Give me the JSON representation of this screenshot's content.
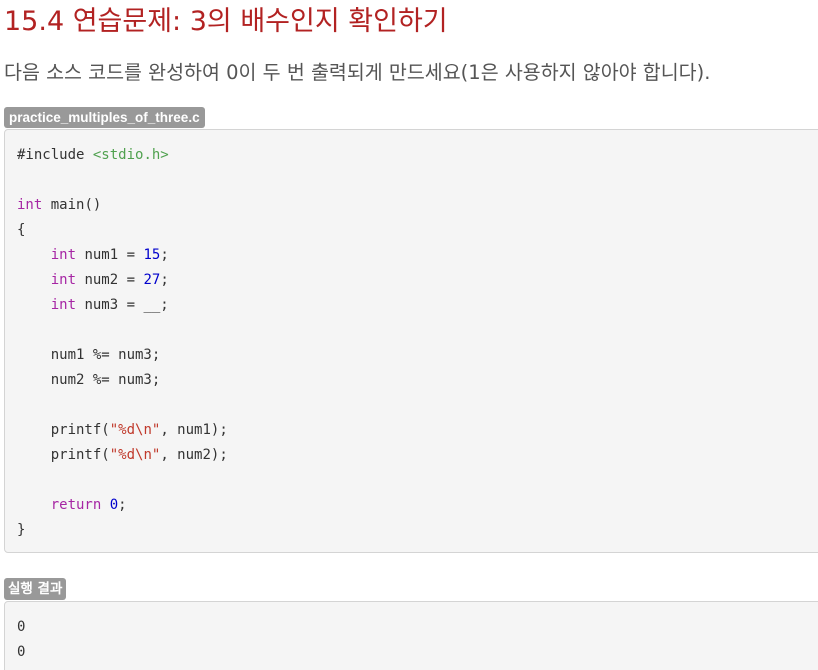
{
  "title": "15.4 연습문제: 3의 배수인지 확인하기",
  "instruction": "다음 소스 코드를 완성하여 0이 두 번 출력되게 만드세요(1은 사용하지 않아야 합니다).",
  "code_file": "practice_multiples_of_three.c",
  "code": {
    "include_directive": "#include",
    "include_header": "<stdio.h>",
    "type_int": "int",
    "main_sig": " main()",
    "open_brace": "{",
    "close_brace": "}",
    "var1": " num1 = ",
    "var1_value": "15",
    "var2": " num2 = ",
    "var2_value": "27",
    "var3": " num3 = __;",
    "mod1": "num1 %= num3;",
    "mod2": "num2 %= num3;",
    "printf": "printf(",
    "format": "\"%d\\n\"",
    "arg1": ", num1);",
    "arg2": ", num2);",
    "return_kw": "return",
    "return_value": "0",
    "semicolon": ";"
  },
  "result_label": "실행 결과",
  "output_lines": [
    "0",
    "0"
  ],
  "colors": {
    "title": "#b22222",
    "keyword": "#a626a4",
    "header_string": "#50a14f",
    "number": "#0000cc",
    "string_literal": "#c0392b",
    "label_bg": "#999999",
    "code_bg": "#f5f5f5"
  }
}
